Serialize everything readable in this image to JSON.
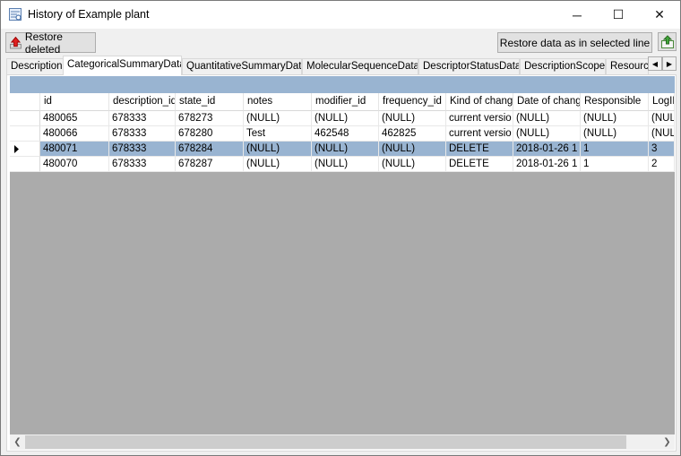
{
  "window": {
    "title": "History of Example plant"
  },
  "window_controls": {
    "minimize": "─",
    "maximize": "☐",
    "close": "✕"
  },
  "toolbar": {
    "restore_deleted_label": "Restore deleted",
    "restore_selected_label": "Restore data as in selected line"
  },
  "tabs": [
    {
      "label": "Description"
    },
    {
      "label": "CategoricalSummaryData"
    },
    {
      "label": "QuantitativeSummaryData"
    },
    {
      "label": "MolecularSequenceData"
    },
    {
      "label": "DescriptorStatusData"
    },
    {
      "label": "DescriptionScope"
    },
    {
      "label": "Resourc"
    }
  ],
  "active_tab": "CategoricalSummaryData",
  "table": {
    "columns": [
      "id",
      "description_id",
      "state_id",
      "notes",
      "modifier_id",
      "frequency_id",
      "Kind of chang",
      "Date of chang",
      "Responsible",
      "LogID"
    ],
    "rows": [
      [
        "480065",
        "678333",
        "678273",
        "(NULL)",
        "(NULL)",
        "(NULL)",
        "current versio",
        "(NULL)",
        "(NULL)",
        "(NULL)"
      ],
      [
        "480066",
        "678333",
        "678280",
        "Test",
        "462548",
        "462825",
        "current versio",
        "(NULL)",
        "(NULL)",
        "(NULL)"
      ],
      [
        "480071",
        "678333",
        "678284",
        "(NULL)",
        "(NULL)",
        "(NULL)",
        "DELETE",
        "2018-01-26 1",
        "1",
        "3"
      ],
      [
        "480070",
        "678333",
        "678287",
        "(NULL)",
        "(NULL)",
        "(NULL)",
        "DELETE",
        "2018-01-26 1",
        "1",
        "2"
      ]
    ],
    "selected_row": 2
  },
  "icons": {
    "window": "history-icon",
    "restore": "red-arrow-up-icon",
    "export": "export-icon",
    "current_row": "row-pointer-icon"
  },
  "colors": {
    "selection": "#99b4d1",
    "grid_background": "#ababab"
  }
}
